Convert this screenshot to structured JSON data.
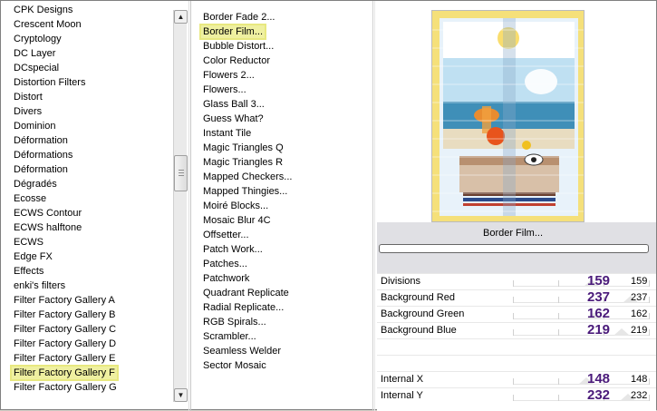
{
  "left_list": {
    "items": [
      "CPK Designs",
      "Crescent Moon",
      "Cryptology",
      "DC Layer",
      "DCspecial",
      "Distortion Filters",
      "Distort",
      "Divers",
      "Dominion",
      "Déformation",
      "Déformations",
      "Déformation",
      "Dégradés",
      "Ecosse",
      "ECWS Contour",
      "ECWS halftone",
      "ECWS",
      "Edge FX",
      "Effects",
      "enki's filters",
      "Filter Factory Gallery A",
      "Filter Factory Gallery B",
      "Filter Factory Gallery C",
      "Filter Factory Gallery D",
      "Filter Factory Gallery E",
      "Filter Factory Gallery F",
      "Filter Factory Gallery G"
    ],
    "selected": "Filter Factory Gallery F"
  },
  "mid_list": {
    "items": [
      "Border Fade 2...",
      "Border Film...",
      "Bubble Distort...",
      "Color Reductor",
      "Flowers 2...",
      "Flowers...",
      "Glass Ball 3...",
      "Guess What?",
      "Instant Tile",
      "Magic Triangles Q",
      "Magic Triangles R",
      "Mapped Checkers...",
      "Mapped Thingies...",
      "Moiré Blocks...",
      "Mosaic Blur 4C",
      "Offsetter...",
      "Patch Work...",
      "Patches...",
      "Patchwork",
      "Quadrant Replicate",
      "Radial Replicate...",
      "RGB Spirals...",
      "Scrambler...",
      "Seamless Welder",
      "Sector Mosaic"
    ],
    "selected": "Border Film..."
  },
  "filter": {
    "title": "Border Film..."
  },
  "params": [
    {
      "label": "Divisions",
      "big": "159",
      "small": "159",
      "level": 0.62
    },
    {
      "label": "Background Red",
      "big": "237",
      "small": "237",
      "level": 0.93
    },
    {
      "label": "Background Green",
      "big": "162",
      "small": "162",
      "level": 0.64
    },
    {
      "label": "Background Blue",
      "big": "219",
      "small": "219",
      "level": 0.86
    },
    {
      "label": "Internal X",
      "big": "148",
      "small": "148",
      "level": 0.58
    },
    {
      "label": "Internal Y",
      "big": "232",
      "small": "232",
      "level": 0.91
    }
  ],
  "colors": {
    "selection_highlight": "#eff0a0",
    "value_text": "#4a1a7a",
    "panel_bg": "#e0e0e4"
  }
}
